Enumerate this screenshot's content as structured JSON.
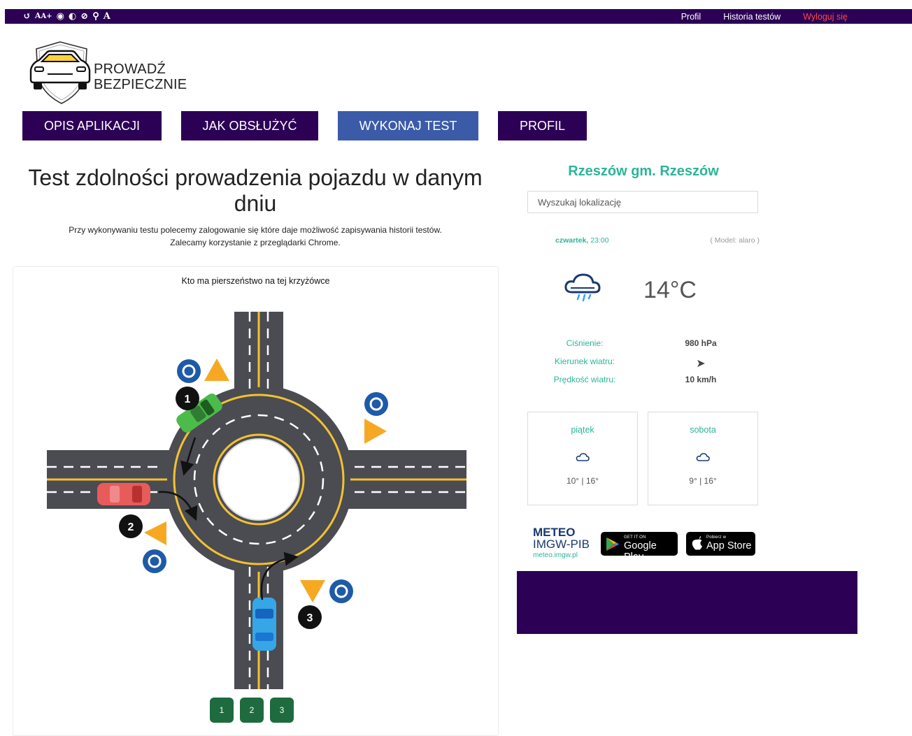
{
  "top_bar": {
    "a11y_icons": [
      "undo-icon",
      "text-size-icon",
      "eye-icon",
      "contrast-icon",
      "hide-icon",
      "link-icon",
      "font-icon"
    ],
    "a11y_glyphs": [
      "↺",
      "A",
      "A+",
      "◉",
      "◐",
      "⊘",
      "⚲",
      "A"
    ],
    "links": {
      "profile": "Profil",
      "history": "Historia testów",
      "logout": "Wyloguj się"
    }
  },
  "logo": {
    "line1": "PROWADŹ",
    "line2": "BEZPIECZNIE"
  },
  "nav": {
    "about": "OPIS APLIKACJI",
    "howto": "JAK OBSŁUŻYĆ",
    "test": "WYKONAJ TEST",
    "profile": "PROFIL"
  },
  "main": {
    "title": "Test zdolności prowadzenia pojazdu w danym dniu",
    "intro_line1": "Przy wykonywaniu testu polecemy zalogowanie się które daje możliwość zapisywania historii testów.",
    "intro_line2": "Zalecamy korzystanie z przeglądarki Chrome.",
    "question": "Kto ma pierszeństwo na tej krzyżówce",
    "car_numbers": [
      "1",
      "2",
      "3"
    ],
    "answers": [
      "1",
      "2",
      "3"
    ]
  },
  "weather": {
    "city": "Rzeszów gm. Rzeszów",
    "search_placeholder": "Wyszukaj lokalizację",
    "day": "czwartek,",
    "time": "23:00",
    "model": "( Model: alaro )",
    "temp": "14°C",
    "pressure_label": "Ciśnienie:",
    "pressure_value": "980 hPa",
    "wind_dir_label": "Kierunek wiatru:",
    "wind_dir_icon": "arrow-icon",
    "wind_dir_glyph": "➤",
    "wind_speed_label": "Prędkość wiatru:",
    "wind_speed_value": "10 km/h",
    "forecast": [
      {
        "name": "piątek",
        "temps": "10° | 16°"
      },
      {
        "name": "sobota",
        "temps": "9° | 16°"
      }
    ],
    "brand": {
      "line1": "METEO",
      "line2": "IMGW-PIB",
      "url": "meteo.imgw.pl"
    },
    "google_play": {
      "small": "GET IT ON",
      "big": "Google Play"
    },
    "app_store": {
      "small": "Pobierz w",
      "big": "App Store"
    }
  },
  "colors": {
    "brand_purple": "#2b0055",
    "active_blue": "#3b5ba9",
    "teal": "#2bb59a",
    "answer_green": "#1d6b3f",
    "logout_red": "#ff4b4b"
  }
}
